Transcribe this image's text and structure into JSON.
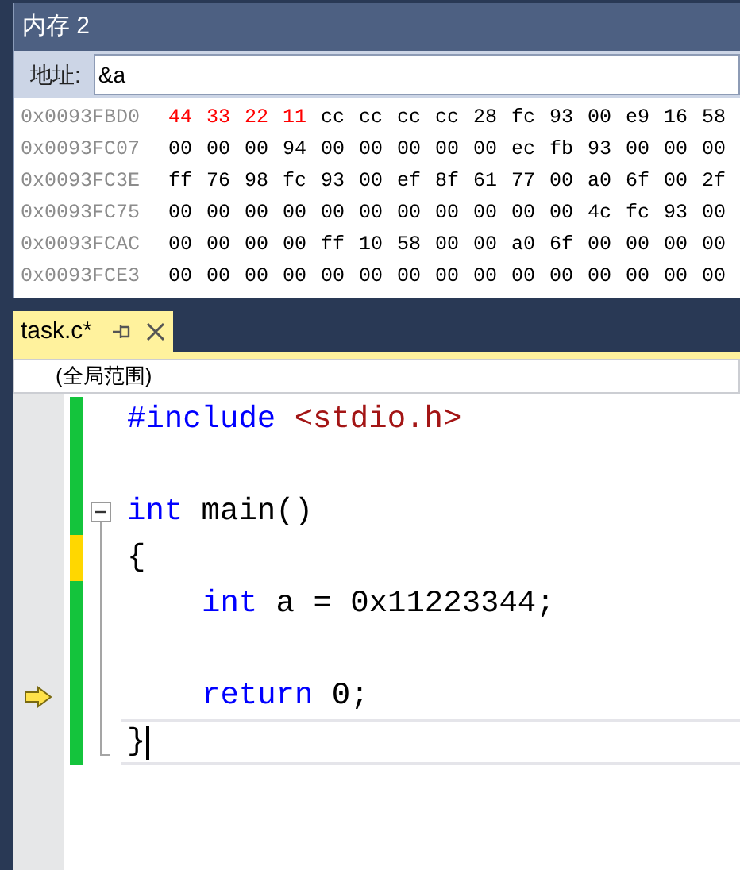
{
  "memory_window": {
    "title": "内存 2",
    "address_label": "地址:",
    "address_value": "&a",
    "rows": [
      {
        "address": "0x0093FBD0",
        "bytes": [
          {
            "text": "44",
            "changed": true
          },
          {
            "text": "33",
            "changed": true
          },
          {
            "text": "22",
            "changed": true
          },
          {
            "text": "11",
            "changed": true
          },
          {
            "text": "cc",
            "changed": false
          },
          {
            "text": "cc",
            "changed": false
          },
          {
            "text": "cc",
            "changed": false
          },
          {
            "text": "cc",
            "changed": false
          },
          {
            "text": "28",
            "changed": false
          },
          {
            "text": "fc",
            "changed": false
          },
          {
            "text": "93",
            "changed": false
          },
          {
            "text": "00",
            "changed": false
          },
          {
            "text": "e9",
            "changed": false
          },
          {
            "text": "16",
            "changed": false
          },
          {
            "text": "58",
            "changed": false
          }
        ]
      },
      {
        "address": "0x0093FC07",
        "bytes": [
          {
            "text": "00",
            "changed": false
          },
          {
            "text": "00",
            "changed": false
          },
          {
            "text": "00",
            "changed": false
          },
          {
            "text": "94",
            "changed": false
          },
          {
            "text": "00",
            "changed": false
          },
          {
            "text": "00",
            "changed": false
          },
          {
            "text": "00",
            "changed": false
          },
          {
            "text": "00",
            "changed": false
          },
          {
            "text": "00",
            "changed": false
          },
          {
            "text": "ec",
            "changed": false
          },
          {
            "text": "fb",
            "changed": false
          },
          {
            "text": "93",
            "changed": false
          },
          {
            "text": "00",
            "changed": false
          },
          {
            "text": "00",
            "changed": false
          },
          {
            "text": "00",
            "changed": false
          }
        ]
      },
      {
        "address": "0x0093FC3E",
        "bytes": [
          {
            "text": "ff",
            "changed": false
          },
          {
            "text": "76",
            "changed": false
          },
          {
            "text": "98",
            "changed": false
          },
          {
            "text": "fc",
            "changed": false
          },
          {
            "text": "93",
            "changed": false
          },
          {
            "text": "00",
            "changed": false
          },
          {
            "text": "ef",
            "changed": false
          },
          {
            "text": "8f",
            "changed": false
          },
          {
            "text": "61",
            "changed": false
          },
          {
            "text": "77",
            "changed": false
          },
          {
            "text": "00",
            "changed": false
          },
          {
            "text": "a0",
            "changed": false
          },
          {
            "text": "6f",
            "changed": false
          },
          {
            "text": "00",
            "changed": false
          },
          {
            "text": "2f",
            "changed": false
          }
        ]
      },
      {
        "address": "0x0093FC75",
        "bytes": [
          {
            "text": "00",
            "changed": false
          },
          {
            "text": "00",
            "changed": false
          },
          {
            "text": "00",
            "changed": false
          },
          {
            "text": "00",
            "changed": false
          },
          {
            "text": "00",
            "changed": false
          },
          {
            "text": "00",
            "changed": false
          },
          {
            "text": "00",
            "changed": false
          },
          {
            "text": "00",
            "changed": false
          },
          {
            "text": "00",
            "changed": false
          },
          {
            "text": "00",
            "changed": false
          },
          {
            "text": "00",
            "changed": false
          },
          {
            "text": "4c",
            "changed": false
          },
          {
            "text": "fc",
            "changed": false
          },
          {
            "text": "93",
            "changed": false
          },
          {
            "text": "00",
            "changed": false
          }
        ]
      },
      {
        "address": "0x0093FCAC",
        "bytes": [
          {
            "text": "00",
            "changed": false
          },
          {
            "text": "00",
            "changed": false
          },
          {
            "text": "00",
            "changed": false
          },
          {
            "text": "00",
            "changed": false
          },
          {
            "text": "ff",
            "changed": false
          },
          {
            "text": "10",
            "changed": false
          },
          {
            "text": "58",
            "changed": false
          },
          {
            "text": "00",
            "changed": false
          },
          {
            "text": "00",
            "changed": false
          },
          {
            "text": "a0",
            "changed": false
          },
          {
            "text": "6f",
            "changed": false
          },
          {
            "text": "00",
            "changed": false
          },
          {
            "text": "00",
            "changed": false
          },
          {
            "text": "00",
            "changed": false
          },
          {
            "text": "00",
            "changed": false
          }
        ]
      },
      {
        "address": "0x0093FCE3",
        "bytes": [
          {
            "text": "00",
            "changed": false
          },
          {
            "text": "00",
            "changed": false
          },
          {
            "text": "00",
            "changed": false
          },
          {
            "text": "00",
            "changed": false
          },
          {
            "text": "00",
            "changed": false
          },
          {
            "text": "00",
            "changed": false
          },
          {
            "text": "00",
            "changed": false
          },
          {
            "text": "00",
            "changed": false
          },
          {
            "text": "00",
            "changed": false
          },
          {
            "text": "00",
            "changed": false
          },
          {
            "text": "00",
            "changed": false
          },
          {
            "text": "00",
            "changed": false
          },
          {
            "text": "00",
            "changed": false
          },
          {
            "text": "00",
            "changed": false
          },
          {
            "text": "00",
            "changed": false
          }
        ]
      }
    ]
  },
  "editor": {
    "tabs": [
      {
        "label": "task.c*",
        "selected": true
      }
    ],
    "scope": "(全局范围)",
    "lines": [
      {
        "unsaved": false,
        "current": false,
        "foldable": false,
        "cursor": false,
        "tokens": [
          {
            "text": "#include",
            "kind": "keyword"
          },
          {
            "text": " <stdio.h>",
            "kind": "string"
          }
        ]
      },
      {
        "unsaved": false,
        "current": false,
        "foldable": false,
        "cursor": false
      },
      {
        "unsaved": false,
        "current": false,
        "foldable": true,
        "cursor": false,
        "tokens": [
          {
            "text": "int",
            "kind": "keyword"
          },
          {
            "text": " main()",
            "kind": "plain"
          }
        ]
      },
      {
        "unsaved": true,
        "current": false,
        "foldable": false,
        "cursor": false,
        "tokens": [
          {
            "text": "{",
            "kind": "plain"
          }
        ],
        "children": [
          {
            "unsaved": false,
            "current": false,
            "foldable": false,
            "cursor": false,
            "tokens": [
              {
                "text": "int",
                "kind": "keyword"
              },
              {
                "text": " a = 0x11223344;",
                "kind": "plain"
              }
            ]
          },
          {
            "unsaved": false,
            "current": false,
            "foldable": false,
            "cursor": false
          },
          {
            "unsaved": false,
            "current": true,
            "foldable": false,
            "cursor": false,
            "tokens": [
              {
                "text": "return",
                "kind": "keyword"
              },
              {
                "text": " 0;",
                "kind": "plain"
              }
            ]
          }
        ]
      },
      {
        "unsaved": false,
        "current": false,
        "foldable": false,
        "cursor": true,
        "tokens": [
          {
            "text": "}",
            "kind": "plain"
          }
        ]
      }
    ]
  }
}
